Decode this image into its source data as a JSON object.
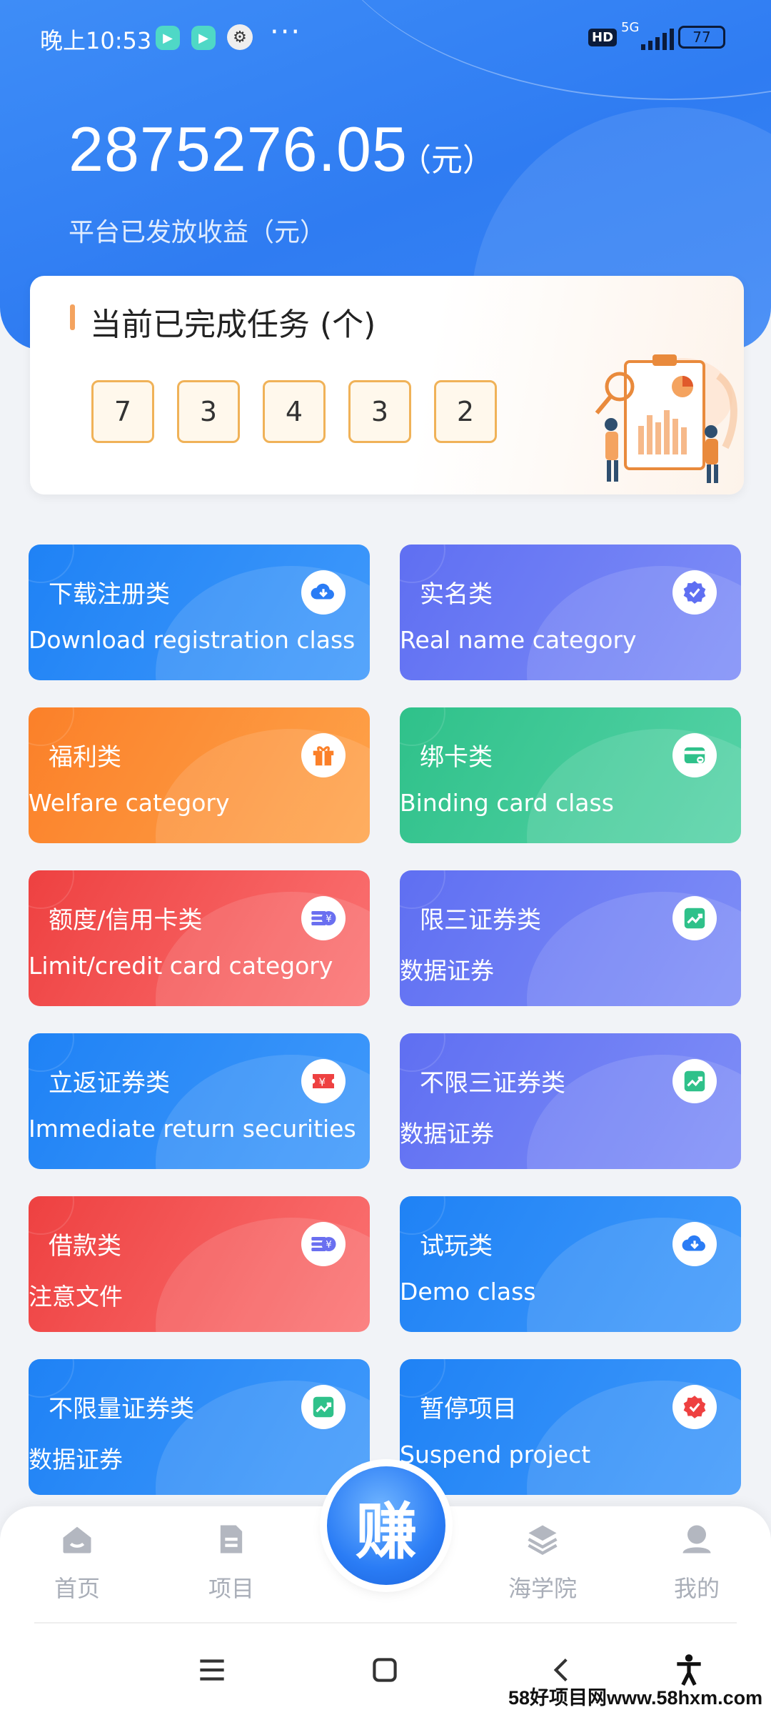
{
  "status_bar": {
    "time": "晚上10:53",
    "more": "···",
    "network": "5G",
    "hd": "HD",
    "battery": "77"
  },
  "hero": {
    "total_amount": "2875276.05",
    "total_unit": "（元）",
    "total_label": "平台已发放收益（元）"
  },
  "tasks": {
    "title": "当前已完成任务 (个)",
    "digits": [
      "7",
      "3",
      "4",
      "3",
      "2"
    ]
  },
  "categories": [
    {
      "title": "下载注册类",
      "subtitle": "Download registration class",
      "icon": "cloud-download-icon",
      "color": "blue"
    },
    {
      "title": "实名类",
      "subtitle": "Real name category",
      "icon": "verified-badge-icon",
      "color": "purple"
    },
    {
      "title": "福利类",
      "subtitle": "Welfare category",
      "icon": "gift-icon",
      "color": "orange"
    },
    {
      "title": "绑卡类",
      "subtitle": "Binding card class",
      "icon": "card-icon",
      "color": "green"
    },
    {
      "title": "额度/信用卡类",
      "subtitle": "Limit/credit card category",
      "icon": "coin-stack-icon",
      "color": "red"
    },
    {
      "title": "限三证券类",
      "subtitle": "数据证券",
      "icon": "trend-chart-icon",
      "color": "purple"
    },
    {
      "title": "立返证券类",
      "subtitle": "Immediate return securities",
      "icon": "ticket-icon",
      "color": "blue"
    },
    {
      "title": "不限三证券类",
      "subtitle": "数据证券",
      "icon": "trend-chart-icon",
      "color": "purple"
    },
    {
      "title": "借款类",
      "subtitle": "注意文件",
      "icon": "coin-stack-icon",
      "color": "red"
    },
    {
      "title": "试玩类",
      "subtitle": "Demo class",
      "icon": "cloud-download-icon",
      "color": "blue"
    },
    {
      "title": "不限量证券类",
      "subtitle": "数据证券",
      "icon": "trend-chart-icon",
      "color": "blue"
    },
    {
      "title": "暂停项目",
      "subtitle": "Suspend project",
      "icon": "badge-red-icon",
      "color": "blue"
    }
  ],
  "bottom_nav": {
    "home": "首页",
    "projects": "项目",
    "earn": "赚",
    "academy": "海学院",
    "mine": "我的"
  },
  "watermark": "58好项目网www.58hxm.com"
}
